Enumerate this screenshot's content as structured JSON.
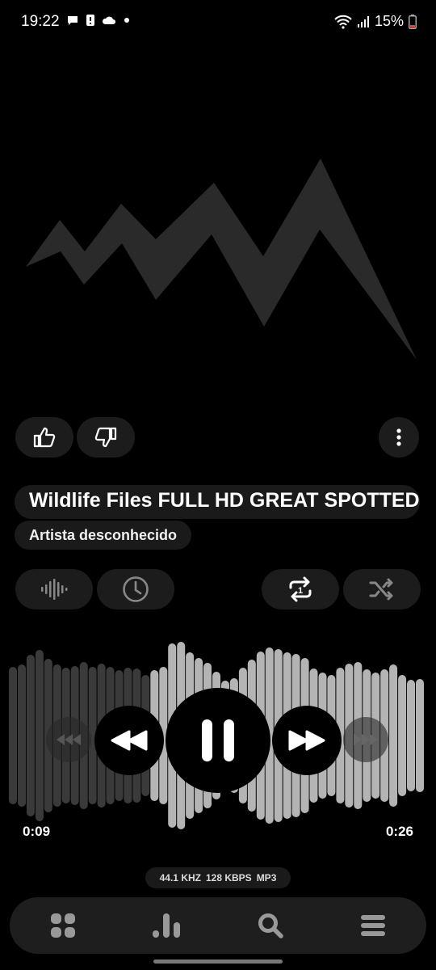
{
  "status_bar": {
    "time": "19:22",
    "battery": "15%",
    "icons": [
      "chat-icon",
      "alert-icon",
      "cloud-icon",
      "dot-icon",
      "wifi-icon",
      "signal-icon",
      "battery-icon"
    ]
  },
  "track": {
    "title": "Wildlife Files FULL HD GREAT SPOTTED",
    "artist": "Artista desconhecido"
  },
  "actions": {
    "like_icon": "thumbs-up-icon",
    "dislike_icon": "thumbs-down-icon",
    "more_icon": "more-vertical-icon"
  },
  "controls_row": {
    "visualizer_icon": "waveform-icon",
    "timer_icon": "clock-icon",
    "repeat_icon": "repeat-one-icon",
    "shuffle_icon": "shuffle-icon"
  },
  "playback": {
    "elapsed": "0:09",
    "duration": "0:26",
    "progress": 0.35,
    "state": "playing"
  },
  "audio_info": {
    "rate": "44.1 KHZ",
    "bitrate": "128 KBPS",
    "format": "MP3"
  },
  "bottom_nav": [
    "grid-icon",
    "bar-chart-icon",
    "search-icon",
    "menu-icon"
  ],
  "colors": {
    "background": "#000000",
    "pill": "#1c1c1c",
    "wave_played": "#3a3a3a",
    "wave_unplayed": "#b4b4b4",
    "art": "#2a2a2a"
  }
}
